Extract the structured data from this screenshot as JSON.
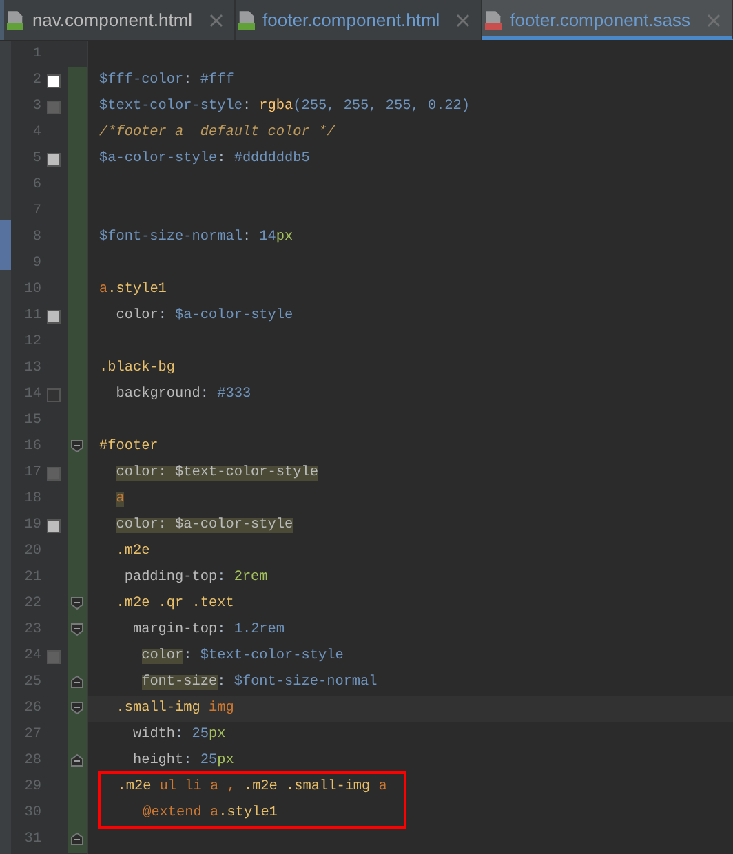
{
  "tabs": [
    {
      "label": "nav.component.html",
      "kind": "html",
      "modified": false,
      "selected": false
    },
    {
      "label": "footer.component.html",
      "kind": "html",
      "modified": true,
      "selected": false
    },
    {
      "label": "footer.component.sass",
      "kind": "sass",
      "modified": true,
      "selected": true
    }
  ],
  "lines": [
    {
      "number": "1",
      "changed": false
    },
    {
      "number": "2",
      "changed": true,
      "color": "#ffffff",
      "tokens": [
        {
          "text": "$fff-color",
          "kind": "var"
        },
        {
          "text": ": ",
          "kind": "punct"
        },
        {
          "text": "#fff",
          "kind": "val"
        }
      ]
    },
    {
      "number": "3",
      "changed": true,
      "color": "#5f5f5f",
      "tokens": [
        {
          "text": "$text-color-style",
          "kind": "var"
        },
        {
          "text": ": ",
          "kind": "punct"
        },
        {
          "text": "rgba",
          "kind": "fn"
        },
        {
          "text": "(255, 255, 255, 0.22)",
          "kind": "val"
        }
      ]
    },
    {
      "number": "4",
      "changed": true,
      "tokens": [
        {
          "text": "/*footer a  default color */",
          "kind": "comment"
        }
      ]
    },
    {
      "number": "5",
      "changed": true,
      "color": "#bdbdbd",
      "tokens": [
        {
          "text": "$a-color-style",
          "kind": "var"
        },
        {
          "text": ": ",
          "kind": "punct"
        },
        {
          "text": "#ddddddb5",
          "kind": "val"
        }
      ]
    },
    {
      "number": "6",
      "changed": true
    },
    {
      "number": "7",
      "changed": true
    },
    {
      "number": "8",
      "changed": true,
      "tokens": [
        {
          "text": "$font-size-normal",
          "kind": "var"
        },
        {
          "text": ": ",
          "kind": "punct"
        },
        {
          "text": "14",
          "kind": "val"
        },
        {
          "text": "px",
          "kind": "unit"
        }
      ]
    },
    {
      "number": "9",
      "changed": true
    },
    {
      "number": "10",
      "changed": true,
      "tokens": [
        {
          "text": "a",
          "kind": "tag"
        },
        {
          "text": ".style1",
          "kind": "sel"
        }
      ]
    },
    {
      "number": "11",
      "changed": true,
      "color": "#bdbdbd",
      "tokens": [
        {
          "text": "  color",
          "kind": "prop"
        },
        {
          "text": ": ",
          "kind": "punct"
        },
        {
          "text": "$a-color-style",
          "kind": "var"
        }
      ]
    },
    {
      "number": "12",
      "changed": true
    },
    {
      "number": "13",
      "changed": true,
      "tokens": [
        {
          "text": ".black-bg",
          "kind": "sel"
        }
      ]
    },
    {
      "number": "14",
      "changed": true,
      "color": "#333333",
      "tokens": [
        {
          "text": "  background",
          "kind": "prop"
        },
        {
          "text": ": ",
          "kind": "punct"
        },
        {
          "text": "#333",
          "kind": "val"
        }
      ]
    },
    {
      "number": "15",
      "changed": true
    },
    {
      "number": "16",
      "changed": true,
      "fold_start": true,
      "tokens": [
        {
          "text": "#footer",
          "kind": "sel"
        }
      ]
    },
    {
      "number": "17",
      "changed": true,
      "color": "#5f5f5f",
      "tokens": [
        {
          "text": "  color: $text-color-style",
          "kind": "prop",
          "highlighted": true
        }
      ]
    },
    {
      "number": "18",
      "changed": true,
      "tokens": [
        {
          "text": "  a",
          "kind": "tag",
          "highlighted": true
        }
      ]
    },
    {
      "number": "19",
      "changed": true,
      "color": "#bdbdbd",
      "tokens": [
        {
          "text": "  color: $a-color-style",
          "kind": "prop",
          "highlighted": true
        }
      ]
    },
    {
      "number": "20",
      "changed": true,
      "tokens": [
        {
          "text": "  .m2e",
          "kind": "sel"
        }
      ]
    },
    {
      "number": "21",
      "changed": true,
      "tokens": [
        {
          "text": "   padding-top",
          "kind": "prop"
        },
        {
          "text": ": ",
          "kind": "punct"
        },
        {
          "text": "2rem",
          "kind": "unit"
        }
      ]
    },
    {
      "number": "22",
      "changed": true,
      "fold_start": true,
      "tokens": [
        {
          "text": "  .m2e .qr .text",
          "kind": "sel"
        }
      ]
    },
    {
      "number": "23",
      "changed": true,
      "fold_start": true,
      "tokens": [
        {
          "text": "    margin-top",
          "kind": "prop"
        },
        {
          "text": ": ",
          "kind": "punct"
        },
        {
          "text": "1.2rem",
          "kind": "val"
        }
      ]
    },
    {
      "number": "24",
      "changed": true,
      "color": "#5f5f5f",
      "tokens": [
        {
          "text": "     color",
          "kind": "prop",
          "highlighted": true
        },
        {
          "text": ": ",
          "kind": "punct"
        },
        {
          "text": "$text-color-style",
          "kind": "var"
        }
      ]
    },
    {
      "number": "25",
      "changed": true,
      "fold_end": true,
      "tokens": [
        {
          "text": "     font-size",
          "kind": "prop",
          "highlighted": true
        },
        {
          "text": ": ",
          "kind": "punct"
        },
        {
          "text": "$font-size-normal",
          "kind": "var"
        }
      ]
    },
    {
      "number": "26",
      "changed": true,
      "fold_start": true,
      "current": true,
      "tokens": [
        {
          "text": "  .small-img ",
          "kind": "sel"
        },
        {
          "text": "img",
          "kind": "tag"
        }
      ]
    },
    {
      "number": "27",
      "changed": true,
      "tokens": [
        {
          "text": "    width",
          "kind": "prop"
        },
        {
          "text": ": ",
          "kind": "punct"
        },
        {
          "text": "25",
          "kind": "val"
        },
        {
          "text": "px",
          "kind": "unit"
        }
      ]
    },
    {
      "number": "28",
      "changed": true,
      "fold_end": true,
      "tokens": [
        {
          "text": "    height",
          "kind": "prop"
        },
        {
          "text": ": ",
          "kind": "punct"
        },
        {
          "text": "25",
          "kind": "val"
        },
        {
          "text": "px",
          "kind": "unit"
        }
      ]
    },
    {
      "number": "29",
      "changed": true,
      "boxed": true,
      "tokens": [
        {
          "text": "  .m2e ",
          "kind": "sel"
        },
        {
          "text": "ul li a , ",
          "kind": "tag"
        },
        {
          "text": ".m2e .small-img ",
          "kind": "sel"
        },
        {
          "text": "a",
          "kind": "tag"
        }
      ]
    },
    {
      "number": "30",
      "changed": true,
      "boxed": true,
      "tokens": [
        {
          "text": "     @extend ",
          "kind": "tag"
        },
        {
          "text": "a",
          "kind": "tag"
        },
        {
          "text": ".style1",
          "kind": "sel"
        }
      ]
    },
    {
      "number": "31",
      "changed": true,
      "fold_end": true
    }
  ]
}
